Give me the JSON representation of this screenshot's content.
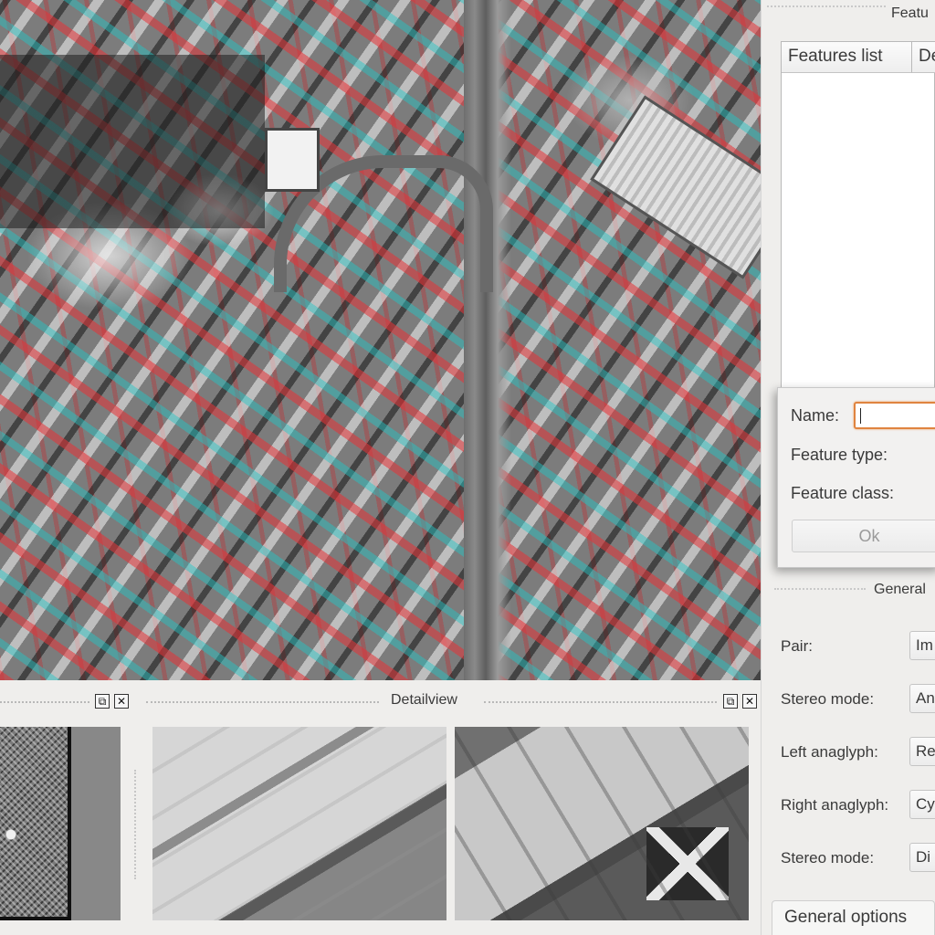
{
  "features_panel": {
    "title": "Featu",
    "table_columns": [
      "Features list",
      "De"
    ]
  },
  "feature_dialog": {
    "name_label": "Name:",
    "name_value": "",
    "feature_type_label": "Feature type:",
    "feature_class_label": "Feature class:",
    "ok_label": "Ok"
  },
  "general_panel": {
    "title": "General",
    "options": [
      {
        "label": "Pair:",
        "value": "Im"
      },
      {
        "label": "Stereo mode:",
        "value": "An"
      },
      {
        "label": "Left anaglyph:",
        "value": "Re"
      },
      {
        "label": "Right anaglyph:",
        "value": "Cy"
      },
      {
        "label": "Stereo mode:",
        "value": "Di"
      }
    ],
    "tab_label": "General options"
  },
  "detail_view": {
    "title": "Detailview",
    "float_glyph": "⧉",
    "close_glyph": "✕"
  },
  "colors": {
    "focus_accent": "#e0843f",
    "anaglyph_red": "#e63237",
    "anaglyph_cyan": "#1ec8c8"
  }
}
